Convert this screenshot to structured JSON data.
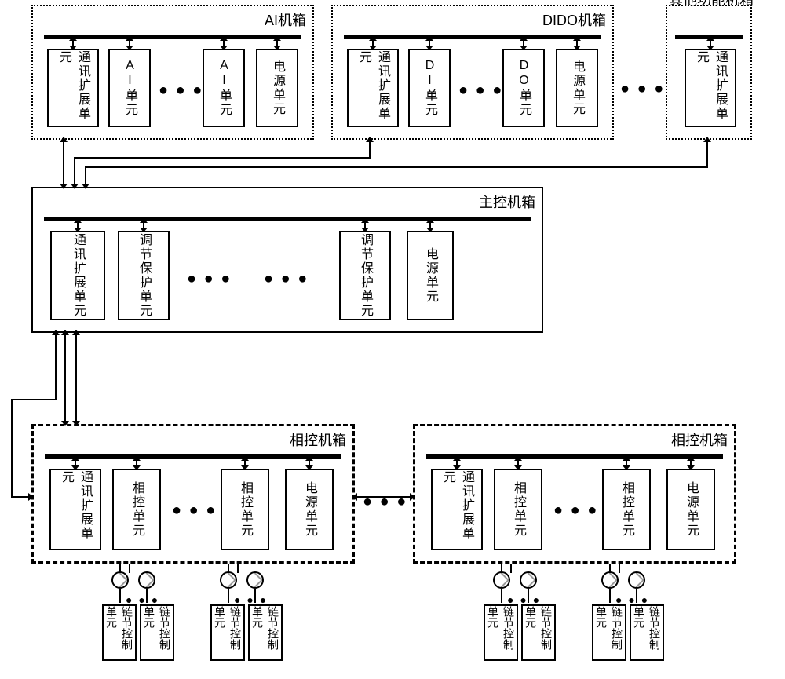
{
  "chassis": {
    "ai": {
      "title": "AI机箱"
    },
    "dido": {
      "title": "DIDO机箱"
    },
    "other": {
      "title": "其他功能机箱"
    },
    "main": {
      "title": "主控机箱"
    },
    "phaseA": {
      "title": "相控机箱"
    },
    "phaseB": {
      "title": "相控机箱"
    }
  },
  "units": {
    "comm_ext": "通讯扩展单元",
    "ai_unit": "AI单元",
    "di_unit": "DI单元",
    "do_unit": "DO单元",
    "power": "电源单元",
    "reg_prot": "调节保护单元",
    "phase": "相控单元"
  },
  "link_ctrl": "链节控制单元",
  "ellipsis": "● ● ●"
}
